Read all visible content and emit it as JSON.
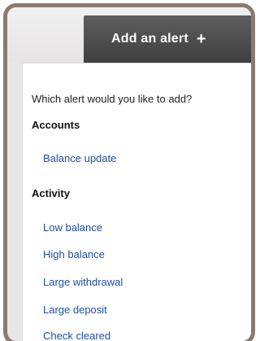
{
  "header": {
    "add_alert_label": "Add an alert",
    "plus_glyph": "+"
  },
  "panel": {
    "prompt": "Which alert would you like to add?",
    "sections": [
      {
        "title": "Accounts",
        "items": [
          "Balance update"
        ]
      },
      {
        "title": "Activity",
        "items": [
          "Low balance",
          "High balance",
          "Large withdrawal",
          "Large deposit",
          "Check cleared"
        ]
      }
    ]
  },
  "colors": {
    "frame": "#8a7a74",
    "button": "#4a4a4a",
    "link": "#1f4fa6"
  }
}
